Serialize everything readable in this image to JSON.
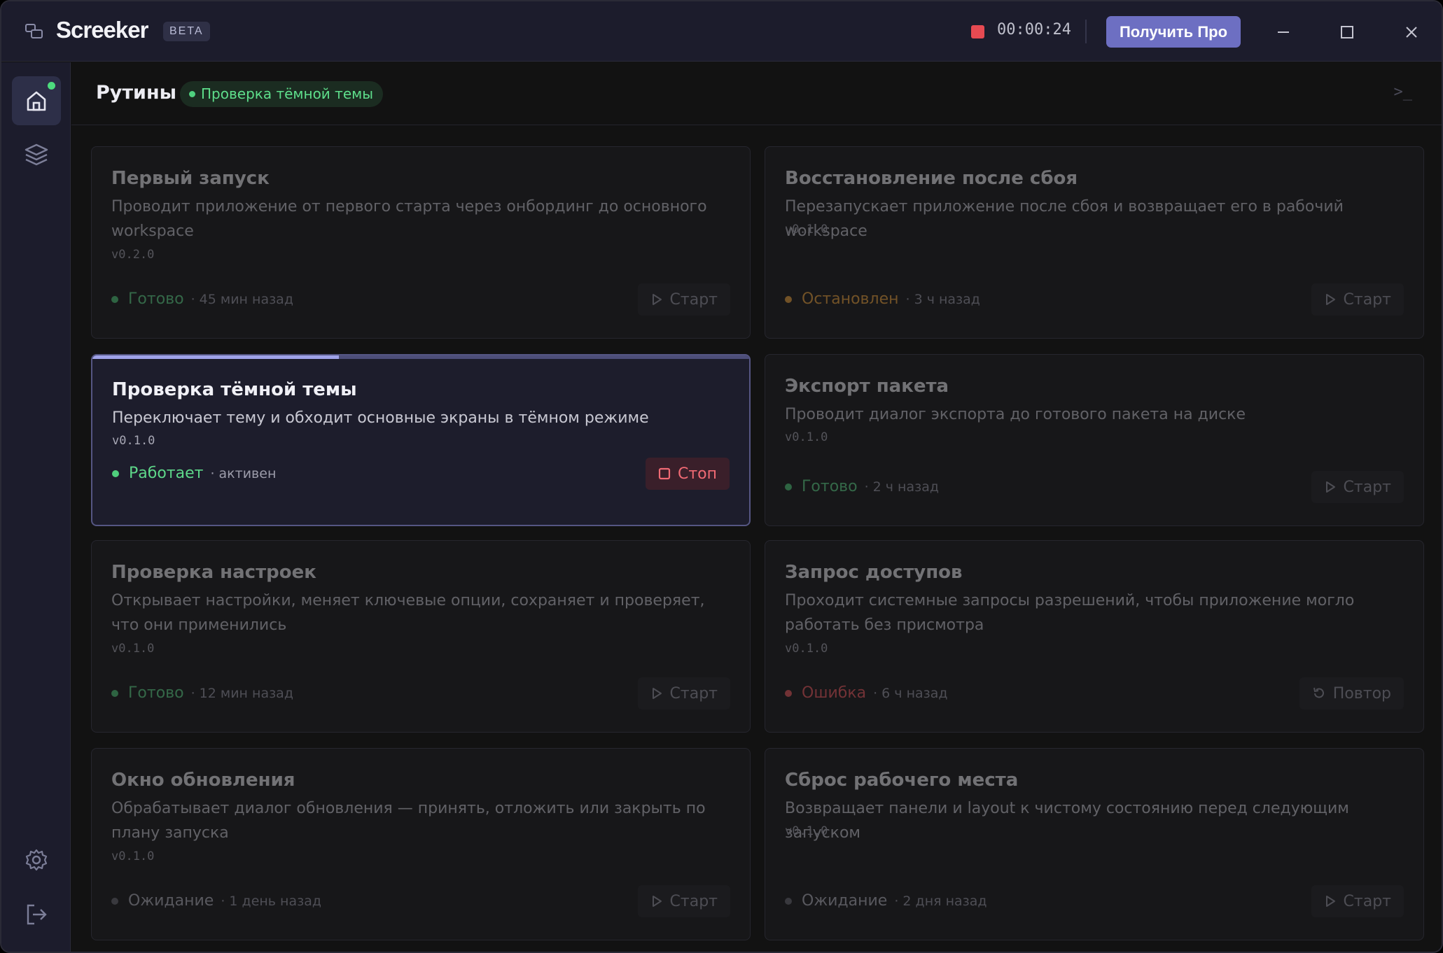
{
  "app": {
    "name": "Screeker",
    "badge": "BETA",
    "recording_time": "00:00:24",
    "pro_button": "Получить Про"
  },
  "header": {
    "title": "Рутины",
    "active_routine": "Проверка тёмной темы",
    "terminal_glyph": ">_"
  },
  "sidebar": {
    "items": [
      {
        "icon": "home-icon",
        "active": true
      },
      {
        "icon": "layers-icon",
        "active": false
      },
      {
        "icon": "gear-icon",
        "active": false
      },
      {
        "icon": "logout-icon",
        "active": false
      }
    ]
  },
  "routines": [
    {
      "title": "Первый запуск",
      "desc": "Проводит приложение от первого старта через онбординг до основного workspace",
      "version": "v0.2.0",
      "status": "Готово",
      "time": "· 45 мин назад",
      "button": "Старт"
    },
    {
      "title": "Восстановление после сбоя",
      "desc": "Перезапускает приложение после сбоя и возвращает его в рабочий workspace",
      "version": "v0.1.0",
      "status": "Остановлен",
      "time": "· 3 ч назад",
      "button": "Старт"
    },
    {
      "title": "Проверка тёмной темы",
      "desc": "Переключает тему и обходит основные экраны в тёмном режиме",
      "version": "v0.1.0",
      "status": "Работает",
      "time": "· активен",
      "button": "Стоп",
      "progress": 0.375
    },
    {
      "title": "Экспорт пакета",
      "desc": "Проводит диалог экспорта до готового пакета на диске",
      "version": "v0.1.0",
      "status": "Готово",
      "time": "· 2 ч назад",
      "button": "Старт"
    },
    {
      "title": "Проверка настроек",
      "desc": "Открывает настройки, меняет ключевые опции, сохраняет и проверяет, что они применились",
      "version": "v0.1.0",
      "status": "Готово",
      "time": "· 12 мин назад",
      "button": "Старт"
    },
    {
      "title": "Запрос доступов",
      "desc": "Проходит системные запросы разрешений, чтобы приложение могло работать без присмотра",
      "version": "v0.1.0",
      "status": "Ошибка",
      "time": "· 6 ч назад",
      "button": "Повтор"
    },
    {
      "title": "Окно обновления",
      "desc": "Обрабатывает диалог обновления — принять, отложить или закрыть по плану запуска",
      "version": "v0.1.0",
      "status": "Ожидание",
      "time": "· 1 день назад",
      "button": "Старт"
    },
    {
      "title": "Сброс рабочего места",
      "desc": "Возвращает панели и layout к чистому состоянию перед следующим запуском",
      "version": "v0.1.0",
      "status": "Ожидание",
      "time": "· 2 дня назад",
      "button": "Старт"
    }
  ],
  "colors": {
    "accent": "#6d6fc2",
    "ok": "#5ed88a",
    "warn": "#f0a43c",
    "error": "#f35a5f",
    "recording": "#e64a52"
  }
}
